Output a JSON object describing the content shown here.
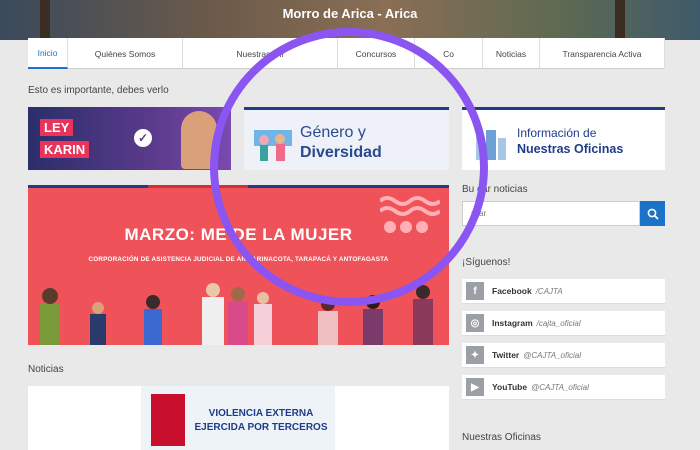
{
  "header": {
    "title": "Morro de Arica - Arica"
  },
  "nav": {
    "items": [
      {
        "label": "Inicio",
        "active": true
      },
      {
        "label": "Quiénes Somos"
      },
      {
        "label": "Nuestras Ofi"
      },
      {
        "label": "Concursos"
      },
      {
        "label": "Co"
      },
      {
        "label": "Noticias"
      },
      {
        "label": "Transparencia Activa"
      }
    ]
  },
  "important": {
    "label": "Esto es importante, debes verlo"
  },
  "banners": {
    "ley": {
      "line1": "LEY",
      "line2": "KARIN"
    },
    "genero": {
      "line1": "Género y",
      "line2": "Diversidad"
    },
    "oficinas": {
      "line1": "Información de",
      "line2": "Nuestras Oficinas"
    }
  },
  "marzo": {
    "headline": "MARZO: ME DE LA MUJER",
    "sub": "CORPORACIÓN DE ASISTENCIA JUDICIAL DE AR PARINACOTA, TARAPACÁ Y ANTOFAGASTA"
  },
  "search": {
    "label": "Bu car noticias",
    "placeholder": "scar"
  },
  "social": {
    "label": "¡Síguenos!",
    "items": [
      {
        "icon": "facebook-icon",
        "glyph": "f",
        "name": "Facebook",
        "handle": "/CAJTA"
      },
      {
        "icon": "instagram-icon",
        "glyph": "◎",
        "name": "Instagram",
        "handle": "/cajta_oficial"
      },
      {
        "icon": "twitter-icon",
        "glyph": "✦",
        "name": "Twitter",
        "handle": "@CAJTA_oficial"
      },
      {
        "icon": "youtube-icon",
        "glyph": "▶",
        "name": "YouTube",
        "handle": "@CAJTA_oficial"
      }
    ]
  },
  "noticias": {
    "label": "Noticias",
    "card": {
      "line1": "VIOLENCIA EXTERNA",
      "line2": "EJERCIDA POR TERCEROS"
    }
  },
  "oficinas_label": "Nuestras Oficinas",
  "colors": {
    "accent": "#1a73c8",
    "brand_red": "#d62b3a",
    "marzo_bg": "#f0525a",
    "overlay": "#8a55f0"
  }
}
